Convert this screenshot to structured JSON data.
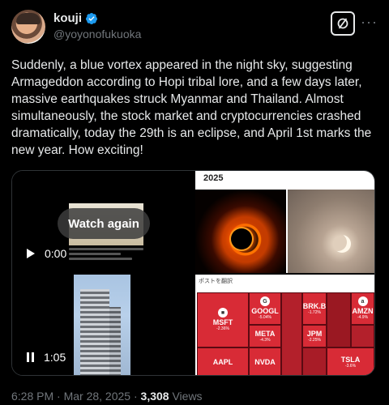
{
  "user": {
    "name": "kouji",
    "handle": "@yoyonofukuoka",
    "verified": true
  },
  "header": {
    "grok_icon": "slashed-circle-icon",
    "more_icon": "more-dots-icon"
  },
  "tweet": {
    "text": "Suddenly, a blue vortex appeared in the night sky, suggesting Armageddon according to Hopi tribal lore, and a few days later, massive earthquakes struck Myanmar and Thailand. Almost simultaneously, the stock market and cryptocurrencies crashed dramatically, today the 29th is an eclipse, and April 1st marks the new year. How exciting!"
  },
  "media": {
    "video": {
      "watch_again": "Watch again",
      "time_top": "0:00",
      "time_bottom": "1:05"
    },
    "eclipse_panel": {
      "label": "2025"
    },
    "market_panel": {
      "label": "ポストを翻訳",
      "tickers": [
        {
          "symbol": "GOOGL",
          "change": "-5.04%"
        },
        {
          "symbol": "MSFT",
          "change": "-2.36%"
        },
        {
          "symbol": "META",
          "change": "-4.3%"
        },
        {
          "symbol": "BRK.B",
          "change": "-1.72%"
        },
        {
          "symbol": "JPM",
          "change": "-2.25%"
        },
        {
          "symbol": "AMZN",
          "change": "-4.9%"
        },
        {
          "symbol": "TSLA",
          "change": "-3.6%"
        },
        {
          "symbol": "AAPL",
          "change": ""
        },
        {
          "symbol": "NVDA",
          "change": ""
        }
      ]
    }
  },
  "footer": {
    "time": "6:28 PM · Mar 28, 2025 · ",
    "views_count": "3,308",
    "views_label": " Views"
  },
  "colors": {
    "background": "#000000",
    "text": "#e7e9ea",
    "muted": "#71767b",
    "verified": "#1d9bf0",
    "loss": "#d82b36"
  }
}
